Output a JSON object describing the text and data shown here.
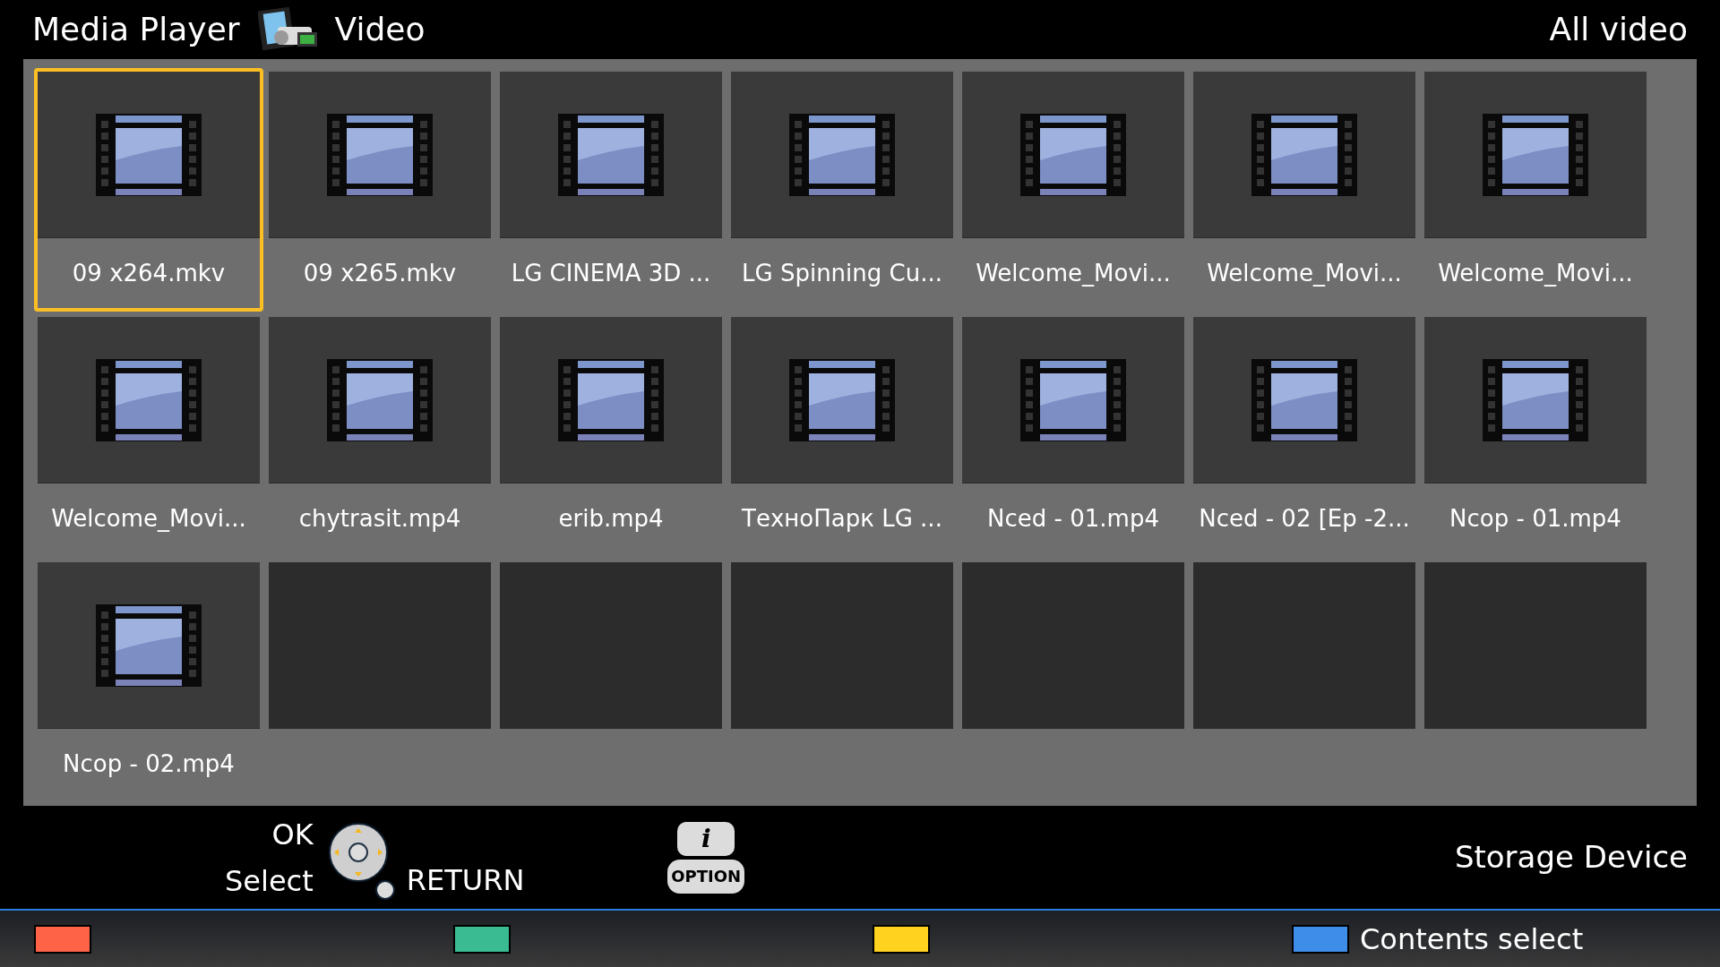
{
  "header": {
    "app_title": "Media Player",
    "section": "Video",
    "filter": "All video"
  },
  "tiles": [
    {
      "kind": "video",
      "name": "09 x264.mkv",
      "selected": true
    },
    {
      "kind": "video",
      "name": "09 x265.mkv",
      "selected": false
    },
    {
      "kind": "video",
      "name": "LG CINEMA 3D ...",
      "selected": false
    },
    {
      "kind": "video",
      "name": "LG Spinning Cu...",
      "selected": false
    },
    {
      "kind": "video",
      "name": "Welcome_Movi...",
      "selected": false
    },
    {
      "kind": "video",
      "name": "Welcome_Movi...",
      "selected": false
    },
    {
      "kind": "video",
      "name": "Welcome_Movi...",
      "selected": false
    },
    {
      "kind": "video",
      "name": "Welcome_Movi...",
      "selected": false
    },
    {
      "kind": "video",
      "name": "chytrasit.mp4",
      "selected": false
    },
    {
      "kind": "video",
      "name": "erib.mp4",
      "selected": false
    },
    {
      "kind": "video",
      "name": "ТехноПарк LG ...",
      "selected": false
    },
    {
      "kind": "video",
      "name": "Nced - 01.mp4",
      "selected": false
    },
    {
      "kind": "video",
      "name": "Nced - 02 [Ep -2...",
      "selected": false
    },
    {
      "kind": "video",
      "name": "Ncop - 01.mp4",
      "selected": false
    },
    {
      "kind": "video",
      "name": "Ncop - 02.mp4",
      "selected": false
    },
    {
      "kind": "empty"
    },
    {
      "kind": "empty"
    },
    {
      "kind": "empty"
    },
    {
      "kind": "empty"
    },
    {
      "kind": "empty"
    },
    {
      "kind": "empty"
    }
  ],
  "guide": {
    "ok": "OK",
    "select": "Select",
    "return": "RETURN",
    "info_key": "i",
    "option_key": "OPTION",
    "storage": "Storage Device"
  },
  "color_keys": [
    {
      "color": "#ff6347"
    },
    {
      "color": "#3bbb91"
    },
    {
      "color": "#ffd21f"
    },
    {
      "color": "#3e8de8",
      "label": "Contents select"
    }
  ]
}
